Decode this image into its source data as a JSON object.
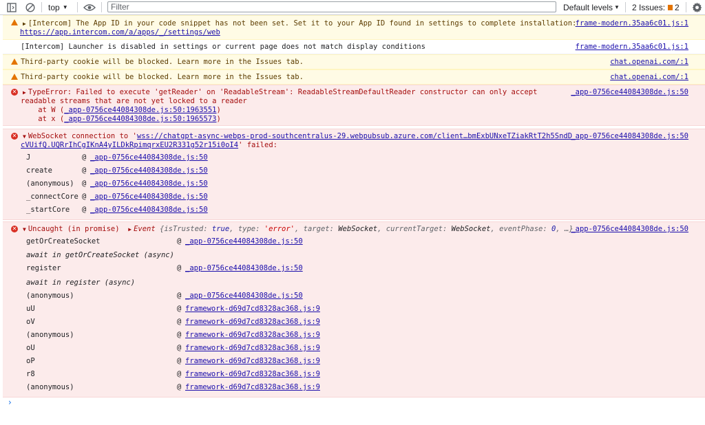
{
  "toolbar": {
    "context": "top",
    "filter_placeholder": "Filter",
    "levels": "Default levels",
    "issues_label": "2 Issues:",
    "issues_count": "2"
  },
  "messages": {
    "m1": {
      "text": "[Intercom] The App ID in your code snippet has not been set. Set it to your App ID found in settings to complete installation:",
      "link": "https://app.intercom.com/a/apps/_/settings/web",
      "source": "frame-modern.35aa6c01.js:1"
    },
    "m2": {
      "text": "[Intercom] Launcher is disabled in settings or current page does not match display conditions",
      "source": "frame-modern.35aa6c01.js:1"
    },
    "m3": {
      "text": "Third-party cookie will be blocked. Learn more in the Issues tab.",
      "source": "chat.openai.com/:1"
    },
    "m4": {
      "text": "Third-party cookie will be blocked. Learn more in the Issues tab.",
      "source": "chat.openai.com/:1"
    },
    "m5": {
      "line1": "TypeError: Failed to execute 'getReader' on 'ReadableStream': ReadableStreamDefaultReader constructor can only accept",
      "line2": "readable streams that are not yet locked to a reader",
      "at1_prefix": "    at W (",
      "at1_link": "_app-0756ce44084308de.js:50:1963551",
      "at2_prefix": "    at x (",
      "at2_link": "_app-0756ce44084308de.js:50:1965573",
      "close": ")",
      "source": "_app-0756ce44084308de.js:50"
    },
    "m6": {
      "prefix": "WebSocket connection to '",
      "url1": "wss://chatgpt-async-webps-prod-southcentralus-29.webpubsub.azure.com/client…bmExbUNxeTZiakRtT2h5SndD",
      "url2": "cVUifQ.UQRrIhCgIKnA4yILDkRpimqrxEU2R331g52r15i0oI4",
      "suffix": "' failed:",
      "source": "_app-0756ce44084308de.js:50",
      "stack": [
        {
          "fn": "J",
          "src": "_app-0756ce44084308de.js:50"
        },
        {
          "fn": "create",
          "src": "_app-0756ce44084308de.js:50"
        },
        {
          "fn": "(anonymous)",
          "src": "_app-0756ce44084308de.js:50"
        },
        {
          "fn": "_connectCore",
          "src": "_app-0756ce44084308de.js:50"
        },
        {
          "fn": "_startCore",
          "src": "_app-0756ce44084308de.js:50"
        }
      ]
    },
    "m7": {
      "prefix": "Uncaught (in promise)",
      "event": "Event",
      "body_a": "{isTrusted: ",
      "v_true": "true",
      "body_b": ", type: ",
      "v_type": "'error'",
      "body_c": ", target: ",
      "v_target": "WebSocket",
      "body_d": ", currentTarget: ",
      "v_ct": "WebSocket",
      "body_e": ", eventPhase: ",
      "v_phase": "0",
      "body_f": ", …}",
      "source": "_app-0756ce44084308de.js:50",
      "stack": [
        {
          "fn": "getOrCreateSocket",
          "src": "_app-0756ce44084308de.js:50"
        },
        {
          "fn": "await in getOrCreateSocket (async)"
        },
        {
          "fn": "register",
          "src": "_app-0756ce44084308de.js:50"
        },
        {
          "fn": "await in register (async)"
        },
        {
          "fn": "(anonymous)",
          "src": "_app-0756ce44084308de.js:50"
        },
        {
          "fn": "uU",
          "src": "framework-d69d7cd8328ac368.js:9"
        },
        {
          "fn": "oV",
          "src": "framework-d69d7cd8328ac368.js:9"
        },
        {
          "fn": "(anonymous)",
          "src": "framework-d69d7cd8328ac368.js:9"
        },
        {
          "fn": "oU",
          "src": "framework-d69d7cd8328ac368.js:9"
        },
        {
          "fn": "oP",
          "src": "framework-d69d7cd8328ac368.js:9"
        },
        {
          "fn": "r8",
          "src": "framework-d69d7cd8328ac368.js:9"
        },
        {
          "fn": "(anonymous)",
          "src": "framework-d69d7cd8328ac368.js:9"
        }
      ]
    },
    "at_sign": "@"
  },
  "colors": {
    "warning": "#e37400",
    "error": "#d93025",
    "link": "#1a0dab",
    "prompt": "#1a73e8"
  },
  "icons": [
    "dock-side-icon",
    "clear-console-icon",
    "live-expression-eye-icon",
    "settings-gear-icon",
    "warning-icon",
    "error-icon",
    "prompt-chevron-icon"
  ]
}
